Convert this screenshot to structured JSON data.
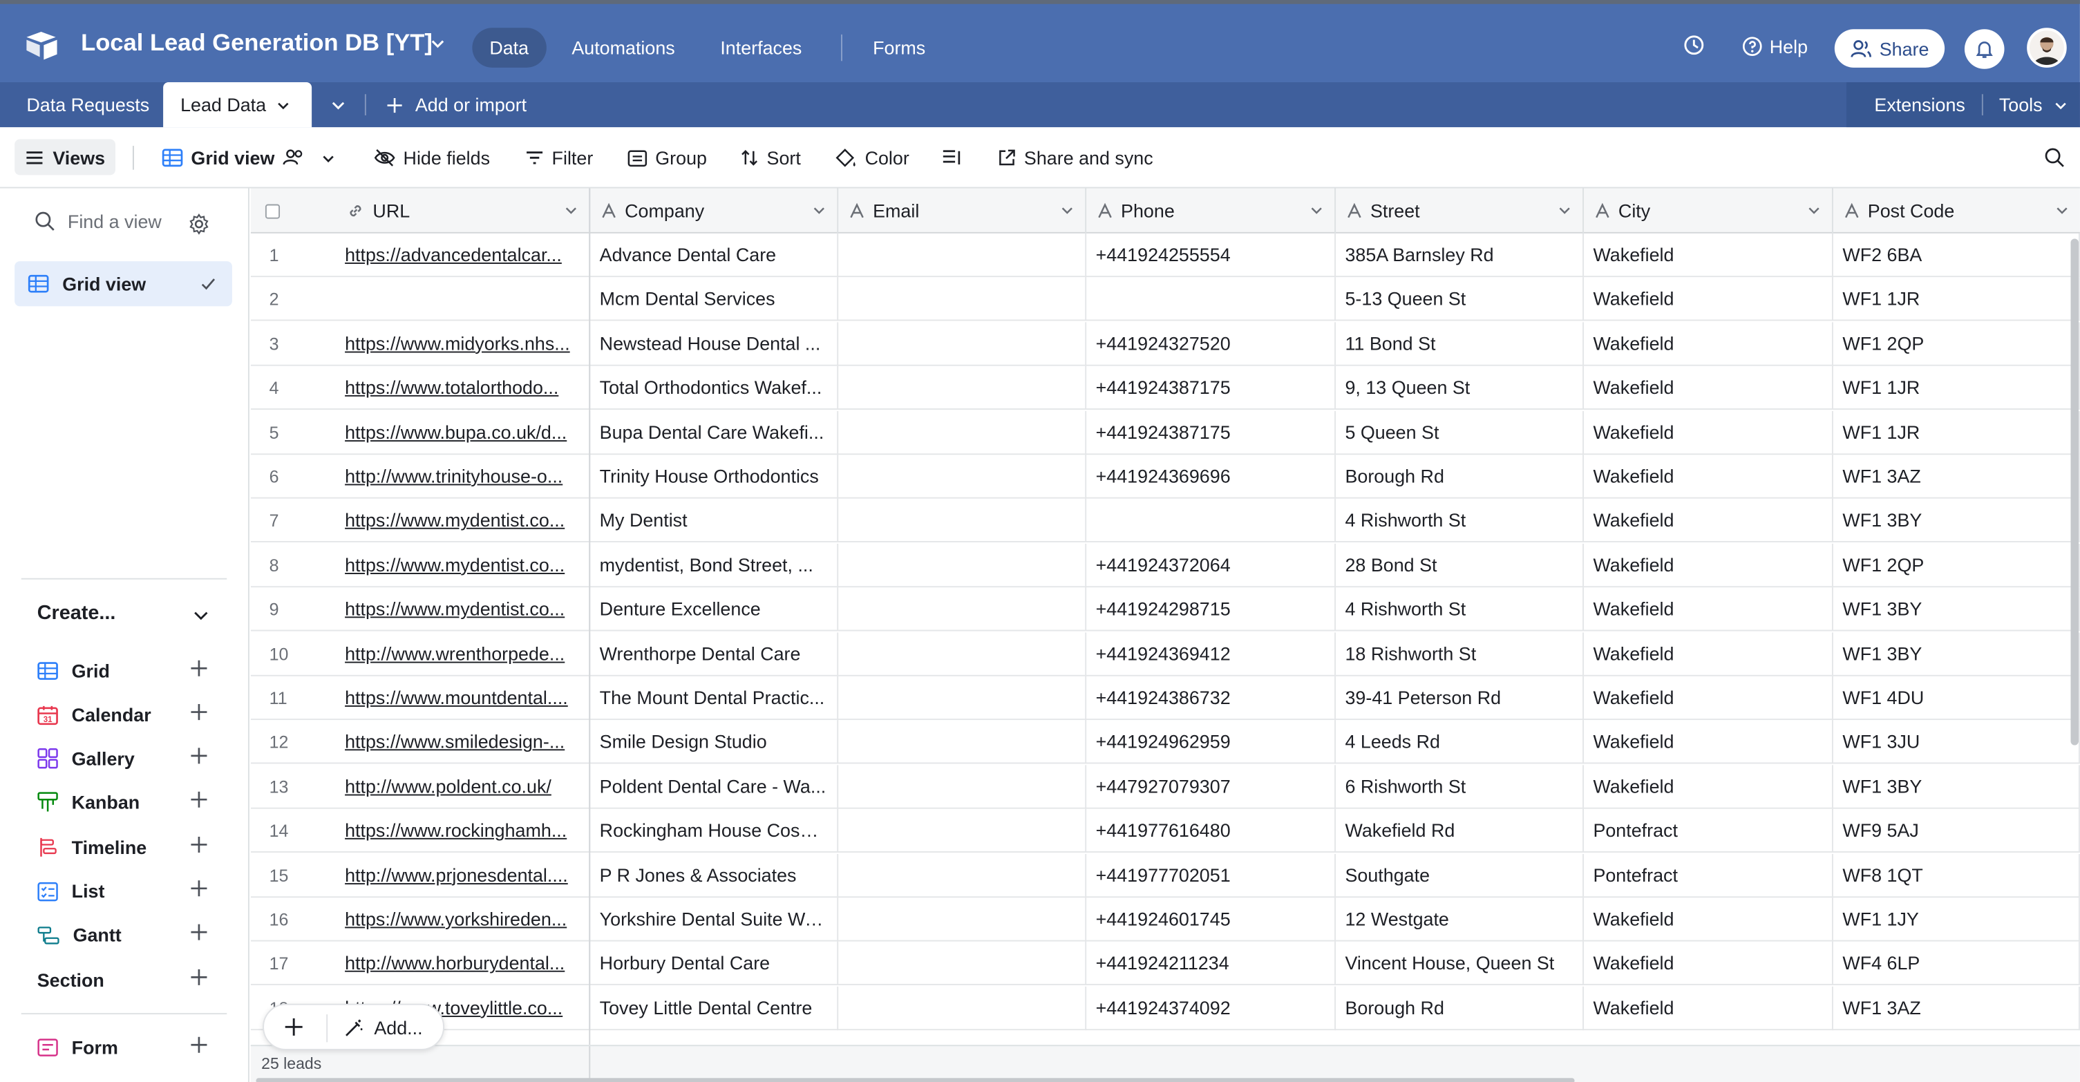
{
  "header": {
    "base_title": "Local Lead Generation DB [YT]",
    "nav": [
      "Data",
      "Automations",
      "Interfaces",
      "Forms"
    ],
    "help_label": "Help",
    "share_label": "Share",
    "brand_color": "#4b6eaf"
  },
  "tabs": {
    "items": [
      "Data Requests",
      "Lead Data"
    ],
    "active": "Lead Data",
    "add_label": "Add or import",
    "extensions_label": "Extensions",
    "tools_label": "Tools"
  },
  "toolbar": {
    "views_label": "Views",
    "view_name": "Grid view",
    "hide_fields": "Hide fields",
    "filter": "Filter",
    "group": "Group",
    "sort": "Sort",
    "color": "Color",
    "share_sync": "Share and sync"
  },
  "sidebar": {
    "find_placeholder": "Find a view",
    "active_view": "Grid view",
    "create_title": "Create...",
    "create_items": [
      {
        "label": "Grid",
        "icon": "grid-icon",
        "color": "#2d7ff9"
      },
      {
        "label": "Calendar",
        "icon": "calendar-icon",
        "color": "#e8384f"
      },
      {
        "label": "Gallery",
        "icon": "gallery-icon",
        "color": "#7c39ed"
      },
      {
        "label": "Kanban",
        "icon": "kanban-icon",
        "color": "#048a0e"
      },
      {
        "label": "Timeline",
        "icon": "timeline-icon",
        "color": "#e8384f"
      },
      {
        "label": "List",
        "icon": "list-icon",
        "color": "#2d7ff9"
      },
      {
        "label": "Gantt",
        "icon": "gantt-icon",
        "color": "#0d7c8c"
      }
    ],
    "section_label": "Section",
    "form_label": "Form",
    "form_color": "#d6338a"
  },
  "grid": {
    "columns": [
      "URL",
      "Company",
      "Email",
      "Phone",
      "Street",
      "City",
      "Post Code"
    ],
    "rows": [
      {
        "n": "1",
        "url": "https://advancedentalcar...",
        "company": "Advance Dental Care",
        "email": "",
        "phone": "+441924255554",
        "street": "385A Barnsley Rd",
        "city": "Wakefield",
        "post": "WF2 6BA"
      },
      {
        "n": "2",
        "url": "",
        "company": "Mcm Dental Services",
        "email": "",
        "phone": "",
        "street": "5-13 Queen St",
        "city": "Wakefield",
        "post": "WF1 1JR"
      },
      {
        "n": "3",
        "url": "https://www.midyorks.nhs...",
        "company": "Newstead House Dental ...",
        "email": "",
        "phone": "+441924327520",
        "street": "11 Bond St",
        "city": "Wakefield",
        "post": "WF1 2QP"
      },
      {
        "n": "4",
        "url": "https://www.totalorthodo...",
        "company": "Total Orthodontics Wakef...",
        "email": "",
        "phone": "+441924387175",
        "street": "9, 13 Queen St",
        "city": "Wakefield",
        "post": "WF1 1JR"
      },
      {
        "n": "5",
        "url": "https://www.bupa.co.uk/d...",
        "company": "Bupa Dental Care Wakefi...",
        "email": "",
        "phone": "+441924387175",
        "street": "5 Queen St",
        "city": "Wakefield",
        "post": "WF1 1JR"
      },
      {
        "n": "6",
        "url": "http://www.trinityhouse-o...",
        "company": "Trinity House Orthodontics",
        "email": "",
        "phone": "+441924369696",
        "street": "Borough Rd",
        "city": "Wakefield",
        "post": "WF1 3AZ"
      },
      {
        "n": "7",
        "url": "https://www.mydentist.co...",
        "company": "My Dentist",
        "email": "",
        "phone": "",
        "street": "4 Rishworth St",
        "city": "Wakefield",
        "post": "WF1 3BY"
      },
      {
        "n": "8",
        "url": "https://www.mydentist.co...",
        "company": "mydentist, Bond Street, ...",
        "email": "",
        "phone": "+441924372064",
        "street": "28 Bond St",
        "city": "Wakefield",
        "post": "WF1 2QP"
      },
      {
        "n": "9",
        "url": "https://www.mydentist.co...",
        "company": "Denture Excellence",
        "email": "",
        "phone": "+441924298715",
        "street": "4 Rishworth St",
        "city": "Wakefield",
        "post": "WF1 3BY"
      },
      {
        "n": "10",
        "url": "http://www.wrenthorpede...",
        "company": "Wrenthorpe Dental Care",
        "email": "",
        "phone": "+441924369412",
        "street": "18 Rishworth St",
        "city": "Wakefield",
        "post": "WF1 3BY"
      },
      {
        "n": "11",
        "url": "https://www.mountdental....",
        "company": "The Mount Dental Practic...",
        "email": "",
        "phone": "+441924386732",
        "street": "39-41 Peterson Rd",
        "city": "Wakefield",
        "post": "WF1 4DU"
      },
      {
        "n": "12",
        "url": "https://www.smiledesign-...",
        "company": "Smile Design Studio",
        "email": "",
        "phone": "+441924962959",
        "street": "4 Leeds Rd",
        "city": "Wakefield",
        "post": "WF1 3JU"
      },
      {
        "n": "13",
        "url": "http://www.poldent.co.uk/",
        "company": "Poldent Dental Care - Wa...",
        "email": "",
        "phone": "+447927079307",
        "street": "6 Rishworth St",
        "city": "Wakefield",
        "post": "WF1 3BY"
      },
      {
        "n": "14",
        "url": "https://www.rockinghamh...",
        "company": "Rockingham House Cosm...",
        "email": "",
        "phone": "+441977616480",
        "street": "Wakefield Rd",
        "city": "Pontefract",
        "post": "WF9 5AJ"
      },
      {
        "n": "15",
        "url": "http://www.prjonesdental....",
        "company": "P R Jones & Associates",
        "email": "",
        "phone": "+441977702051",
        "street": "Southgate",
        "city": "Pontefract",
        "post": "WF8 1QT"
      },
      {
        "n": "16",
        "url": "https://www.yorkshireden...",
        "company": "Yorkshire Dental Suite Wa...",
        "email": "",
        "phone": "+441924601745",
        "street": "12 Westgate",
        "city": "Wakefield",
        "post": "WF1 1JY"
      },
      {
        "n": "17",
        "url": "http://www.horburydental...",
        "company": "Horbury Dental Care",
        "email": "",
        "phone": "+441924211234",
        "street": "Vincent House, Queen St",
        "city": "Wakefield",
        "post": "WF4 6LP"
      },
      {
        "n": "18",
        "url": "https://www.toveylittle.co...",
        "company": "Tovey Little Dental Centre",
        "email": "",
        "phone": "+441924374092",
        "street": "Borough Rd",
        "city": "Wakefield",
        "post": "WF1 3AZ"
      }
    ]
  },
  "footer": {
    "record_count": "25 leads",
    "add_label": "Add..."
  }
}
